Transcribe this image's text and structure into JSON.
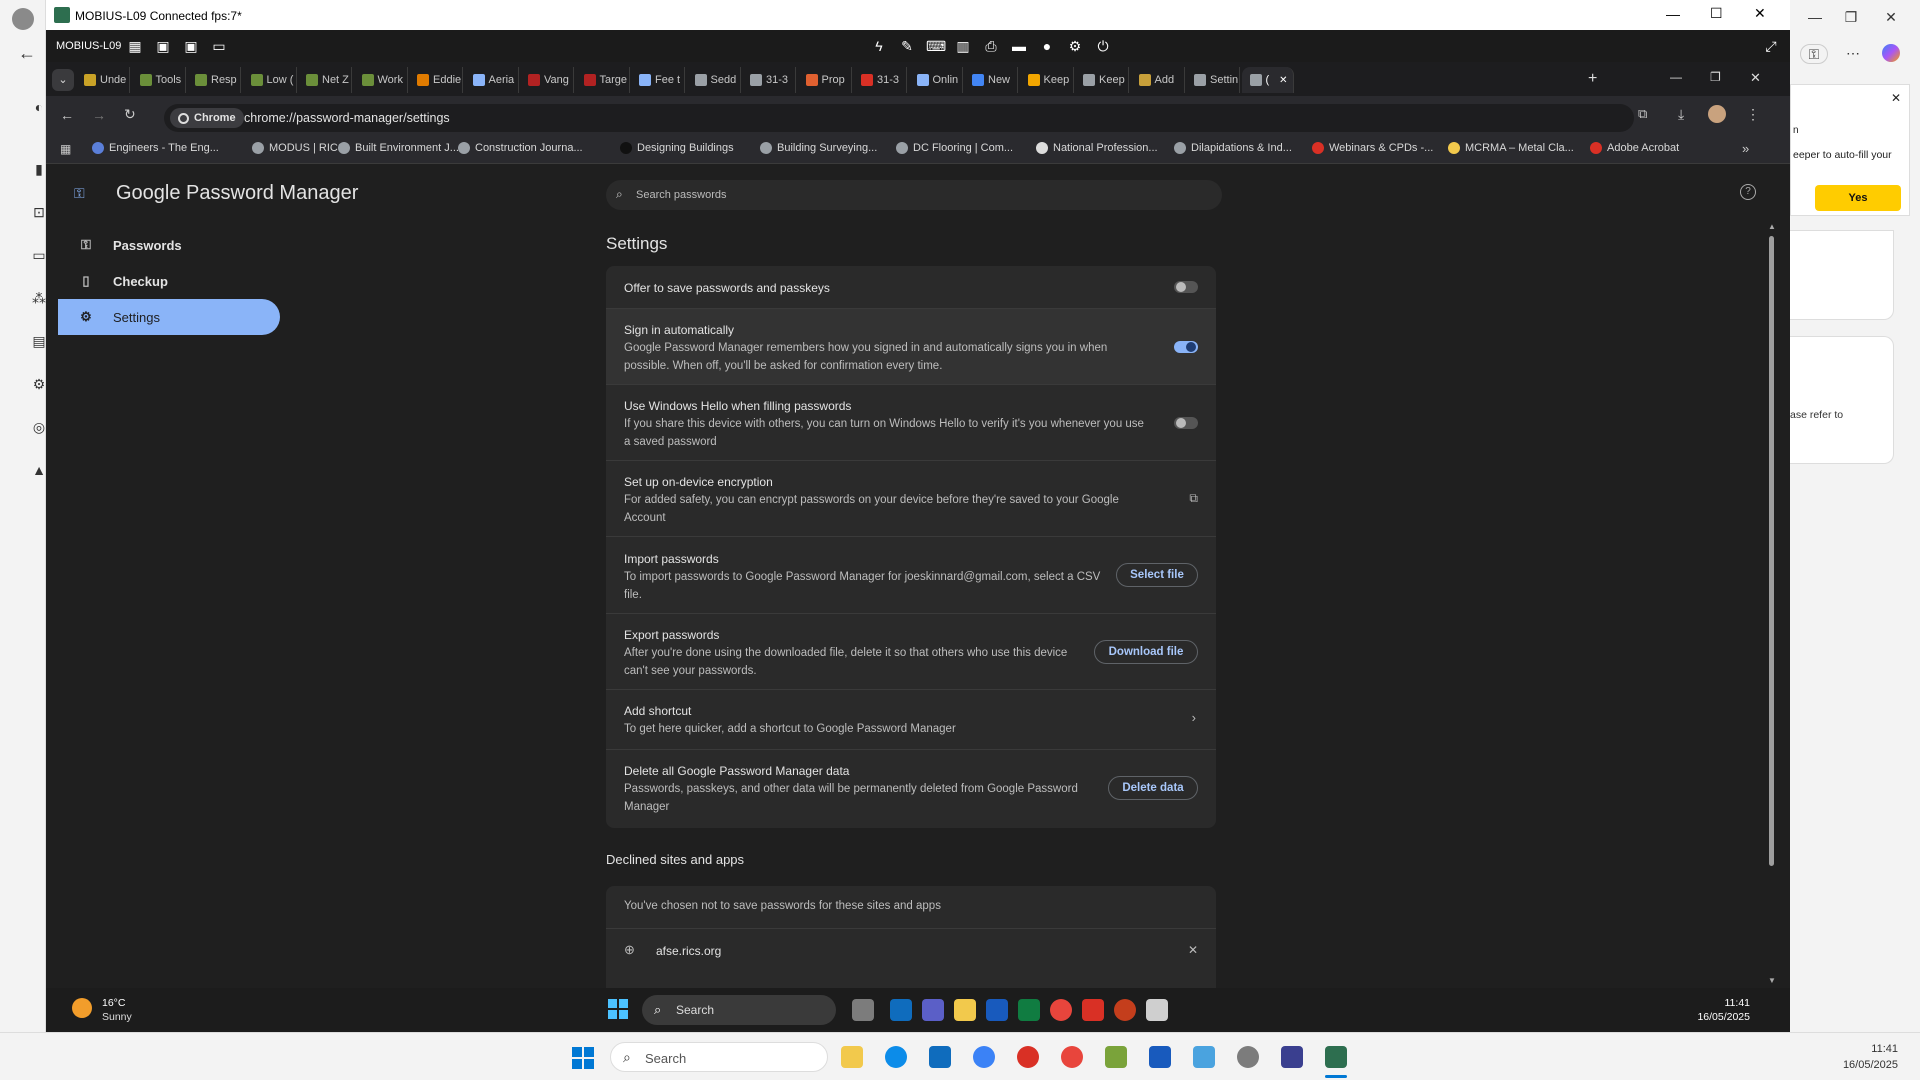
{
  "rdp": {
    "title": "MOBIUS-L09 Connected fps:7*",
    "machine": "MOBIUS-L09"
  },
  "tabs": [
    {
      "label": "Unde"
    },
    {
      "label": "Tools"
    },
    {
      "label": "Resp"
    },
    {
      "label": "Low ("
    },
    {
      "label": "Net Z"
    },
    {
      "label": "Work"
    },
    {
      "label": "Eddie"
    },
    {
      "label": "Aeria"
    },
    {
      "label": "Vang"
    },
    {
      "label": "Targe"
    },
    {
      "label": "Fee t"
    },
    {
      "label": "Sedd"
    },
    {
      "label": "31-3"
    },
    {
      "label": "Prop"
    },
    {
      "label": "31-3"
    },
    {
      "label": "Onlin"
    },
    {
      "label": "New"
    },
    {
      "label": "Keep"
    },
    {
      "label": "Keep"
    },
    {
      "label": "Add"
    },
    {
      "label": "Settin"
    },
    {
      "label": "("
    }
  ],
  "address": {
    "chip": "Chrome",
    "url": "chrome://password-manager/settings"
  },
  "bookmarks": [
    "Engineers - The Eng...",
    "MODUS | RICS",
    "Built Environment J...",
    "Construction Journa...",
    "Designing Buildings",
    "Building Surveying...",
    "DC Flooring | Com...",
    "National Profession...",
    "Dilapidations & Ind...",
    "Webinars & CPDs -...",
    "MCRMA – Metal Cla...",
    "Adobe Acrobat"
  ],
  "app": {
    "title": "Google Password Manager",
    "search_placeholder": "Search passwords"
  },
  "nav": {
    "passwords": "Passwords",
    "checkup": "Checkup",
    "settings": "Settings"
  },
  "settings": {
    "heading": "Settings",
    "offer_save": {
      "title": "Offer to save passwords and passkeys",
      "on": false
    },
    "sign_in": {
      "title": "Sign in automatically",
      "desc1": "Google Password Manager remembers how you signed in and automatically signs you in when",
      "desc2": "possible. When off, you'll be asked for confirmation every time.",
      "on": true
    },
    "windows_hello": {
      "title": "Use Windows Hello when filling passwords",
      "desc1": "If you share this device with others, you can turn on Windows Hello to verify it's you whenever you use",
      "desc2": "a saved password",
      "on": false
    },
    "encryption": {
      "title": "Set up on-device encryption",
      "desc1": "For added safety, you can encrypt passwords on your device before they're saved to your Google",
      "desc2": "Account"
    },
    "import": {
      "title": "Import passwords",
      "desc1": "To import passwords to Google Password Manager for joeskinnard@gmail.com, select a CSV",
      "desc2": "file.",
      "button": "Select file"
    },
    "export": {
      "title": "Export passwords",
      "desc1": "After you're done using the downloaded file, delete it so that others who use this device",
      "desc2": "can't see your passwords.",
      "button": "Download file"
    },
    "shortcut": {
      "title": "Add shortcut",
      "desc1": "To get here quicker, add a shortcut to Google Password Manager"
    },
    "delete": {
      "title": "Delete all Google Password Manager data",
      "desc1": "Passwords, passkeys, and other data will be permanently deleted from Google Password",
      "desc2": "Manager",
      "button": "Delete data"
    }
  },
  "declined": {
    "heading": "Declined sites and apps",
    "note": "You've chosen not to save passwords for these sites and apps",
    "sites": [
      "afse.rics.org"
    ]
  },
  "host_popup": {
    "text1": "eeper to auto-fill your",
    "yes": "Yes",
    "text2": "ase refer to",
    "char": "n"
  },
  "rdp_taskbar": {
    "temp": "16°C",
    "weather": "Sunny",
    "search": "Search",
    "time": "11:41",
    "date": "16/05/2025"
  },
  "host_taskbar": {
    "search": "Search",
    "time": "11:41",
    "date": "16/05/2025"
  }
}
